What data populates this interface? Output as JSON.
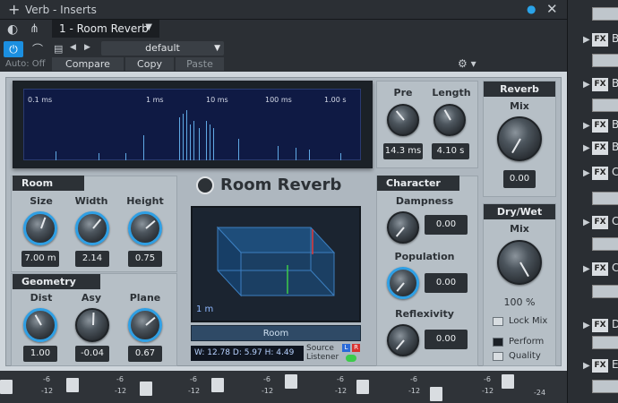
{
  "window": {
    "title": "Verb - Inserts",
    "preset_slot": "1 - Room Reverb",
    "preset_name": "default",
    "auto": "Auto: Off",
    "compare": "Compare",
    "copy": "Copy",
    "paste": "Paste"
  },
  "display": {
    "ticks": [
      "0.1 ms",
      "1 ms",
      "10 ms",
      "100 ms",
      "1.00 s"
    ]
  },
  "room": {
    "header": "Room",
    "size_label": "Size",
    "size_value": "7.00 m",
    "width_label": "Width",
    "width_value": "2.14",
    "height_label": "Height",
    "height_value": "0.75"
  },
  "geometry": {
    "header": "Geometry",
    "dist_label": "Dist",
    "dist_value": "1.00",
    "asy_label": "Asy",
    "asy_value": "-0.04",
    "plane_label": "Plane",
    "plane_value": "0.67"
  },
  "brand": {
    "title": "Room Reverb"
  },
  "view3d": {
    "scale": "1 m",
    "button": "Room",
    "dims": "W: 12.78  D:   5.97  H:  4.49",
    "source": "Source",
    "listener": "Listener",
    "l_badge": "L",
    "r_badge": "R"
  },
  "timing": {
    "pre_label": "Pre",
    "pre_value": "14.3 ms",
    "length_label": "Length",
    "length_value": "4.10 s"
  },
  "character": {
    "header": "Character",
    "dampness_label": "Dampness",
    "dampness_value": "0.00",
    "population_label": "Population",
    "population_value": "0.00",
    "reflexivity_label": "Reflexivity",
    "reflexivity_value": "0.00"
  },
  "reverb": {
    "header": "Reverb",
    "mix_label": "Mix",
    "mix_value": "0.00"
  },
  "drywet": {
    "header": "Dry/Wet",
    "mix_label": "Mix",
    "mix_value": "100 %",
    "lockmix": "Lock Mix",
    "perform": "Perform",
    "quality": "Quality"
  },
  "browser": {
    "rows": [
      {
        "fx": "FX",
        "letter": "B"
      },
      {
        "fx": "FX",
        "letter": "B"
      },
      {
        "fx": "FX",
        "letter": "B"
      },
      {
        "fx": "FX",
        "letter": "B"
      },
      {
        "fx": "FX",
        "letter": "C"
      },
      {
        "fx": "FX",
        "letter": "C"
      },
      {
        "fx": "FX",
        "letter": "C"
      },
      {
        "fx": "FX",
        "letter": "D"
      },
      {
        "fx": "FX",
        "letter": "E"
      }
    ]
  },
  "mixer": {
    "marks": [
      "-6",
      "-12",
      "-6",
      "-12",
      "-6",
      "-12",
      "-6",
      "-12",
      "-6",
      "-12",
      "-6",
      "-12",
      "-6",
      "-12",
      "-24"
    ]
  },
  "colors": {
    "accent": "#2f9fe4",
    "power": "#1b8fe0"
  },
  "icons": [
    "plus-icon",
    "power-icon",
    "routing-icon",
    "pin-icon",
    "close-icon",
    "gear-icon",
    "preset-file-icon",
    "arrow-left-icon",
    "arrow-right-icon",
    "chevron-down-icon"
  ]
}
